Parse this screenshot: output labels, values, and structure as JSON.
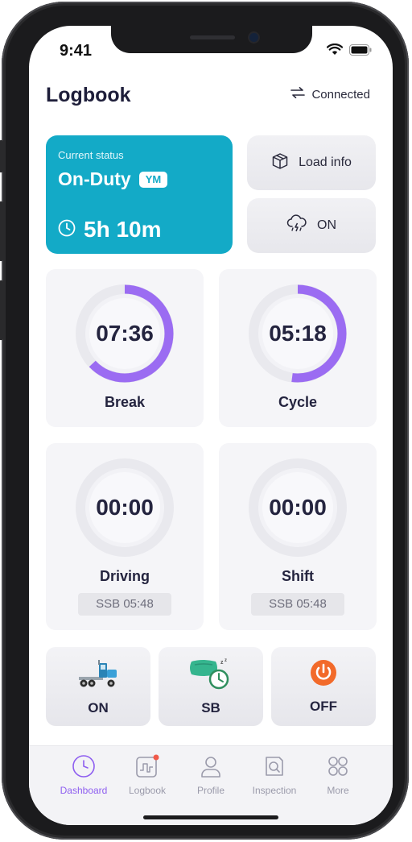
{
  "status_bar": {
    "time": "9:41"
  },
  "header": {
    "title": "Logbook",
    "connection_label": "Connected"
  },
  "current_status": {
    "label": "Current status",
    "state": "On-Duty",
    "badge": "YM",
    "duration": "5h 10m",
    "color": "#13aac7"
  },
  "actions": {
    "load_info_label": "Load info",
    "weather_label": "ON"
  },
  "timers": [
    {
      "label": "Break",
      "value": "07:36",
      "progress": 0.63
    },
    {
      "label": "Cycle",
      "value": "05:18",
      "progress": 0.52
    },
    {
      "label": "Driving",
      "value": "00:00",
      "progress": 0,
      "ssb": "SSB  05:48"
    },
    {
      "label": "Shift",
      "value": "00:00",
      "progress": 0,
      "ssb": "SSB  05:48"
    }
  ],
  "duty_buttons": [
    {
      "label": "ON",
      "icon": "truck-icon"
    },
    {
      "label": "SB",
      "icon": "sleeper-pillow-icon"
    },
    {
      "label": "OFF",
      "icon": "power-icon"
    }
  ],
  "tabs": [
    {
      "label": "Dashboard",
      "icon": "clock-icon",
      "active": true
    },
    {
      "label": "Logbook",
      "icon": "logbook-graph-icon",
      "active": false,
      "badge": true
    },
    {
      "label": "Profile",
      "icon": "person-icon",
      "active": false
    },
    {
      "label": "Inspection",
      "icon": "inspection-search-icon",
      "active": false
    },
    {
      "label": "More",
      "icon": "grid-icon",
      "active": false
    }
  ],
  "colors": {
    "accent": "#8e5ef0",
    "ring": "#9b6cf2",
    "off_orange": "#f26a2a",
    "text_dark": "#24243f"
  }
}
